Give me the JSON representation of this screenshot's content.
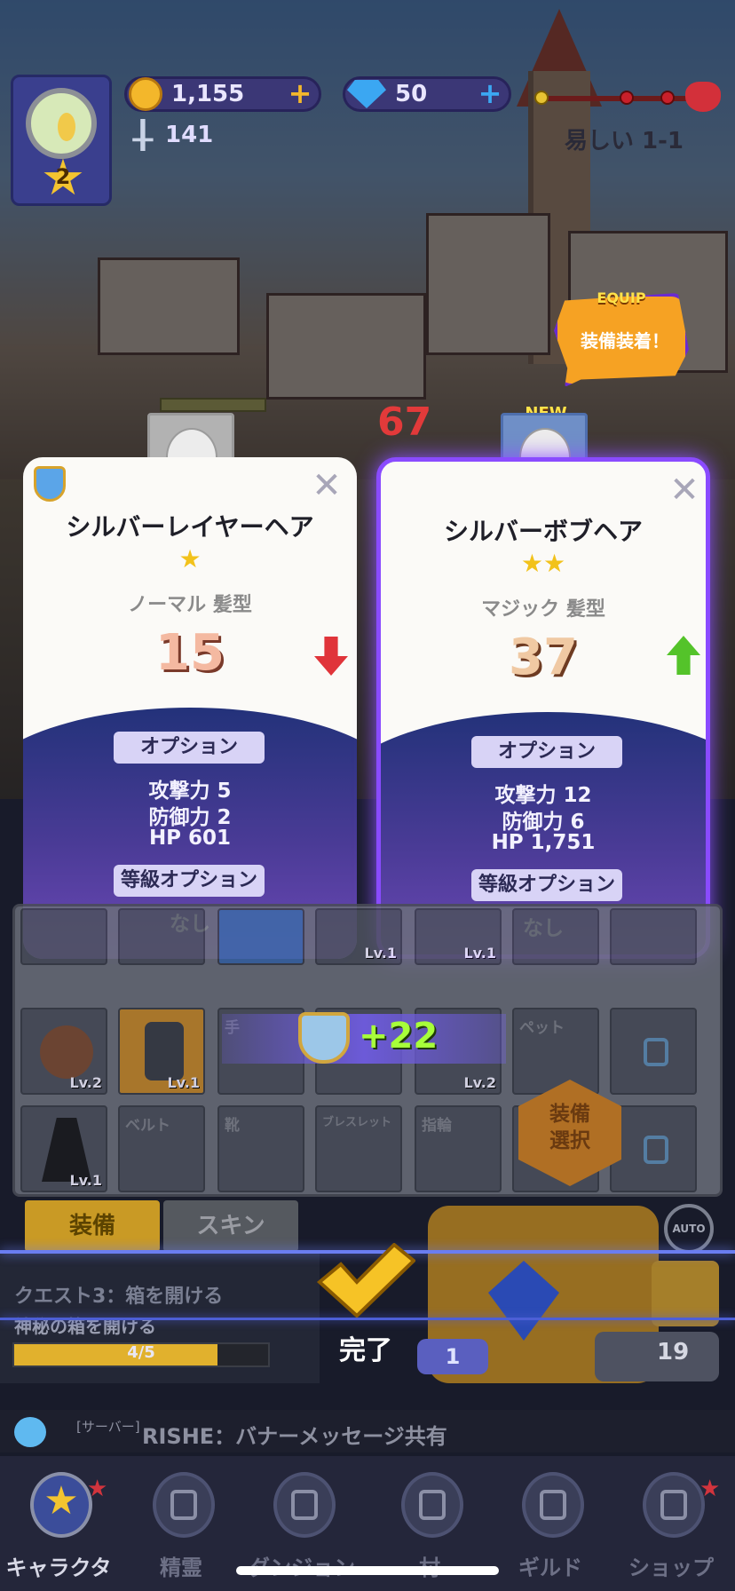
{
  "hud": {
    "player_level": "2",
    "gold": "1,155",
    "gems": "50",
    "combat_power": "141",
    "stage": "易しい 1-1"
  },
  "equip_bubble": {
    "tag": "EQUIP",
    "text": "装備装着！"
  },
  "battle": {
    "damage": "67"
  },
  "cards": [
    {
      "name": "シルバーレイヤーヘア",
      "stars": "★",
      "type": "ノーマル 髪型",
      "power": "15",
      "option_label": "オプション",
      "stats": [
        "攻撃力 5",
        "防御力 2",
        "HP 601"
      ],
      "grade_option_label": "等級オプション",
      "grade_option_value": "なし",
      "comparison": "down"
    },
    {
      "badge": "NEW",
      "name": "シルバーボブヘア",
      "stars": "★★",
      "type": "マジック 髪型",
      "power": "37",
      "option_label": "オプション",
      "stats": [
        "攻撃力 12",
        "防御力 6",
        "HP 1,751"
      ],
      "grade_option_label": "等級オプション",
      "grade_option_value": "なし",
      "comparison": "up"
    }
  ],
  "inventory": {
    "bonus": "+22",
    "slots_row2": [
      {
        "lv": "Lv.2"
      },
      {
        "lv": "Lv.1"
      },
      {
        "label": "手"
      },
      {
        "label": ""
      },
      {
        "lv": "Lv.2"
      },
      {
        "label": "ペット"
      },
      {
        "label": "",
        "locked": true
      }
    ],
    "slots_row3": [
      {
        "lv": "Lv.1"
      },
      {
        "label": "ベルト"
      },
      {
        "label": "靴"
      },
      {
        "label": "ブレスレット"
      },
      {
        "label": "指輪"
      }
    ],
    "slots_row1_lv": [
      "Lv.1",
      "Lv.1"
    ],
    "select_gear": "装備\n選択",
    "tab_equip": "装備",
    "tab_skin": "スキン",
    "auto_label": "AUTO"
  },
  "quest": {
    "title": "クエスト3：箱を開ける",
    "description": "神秘の箱を開ける",
    "progress_text": "4/5",
    "progress_value": 0.8
  },
  "chest": {
    "count": "1",
    "tickets": "19"
  },
  "done": {
    "label": "完了"
  },
  "banner": {
    "tag": "[サーバー]",
    "text": "RISHE：バナーメッセージ共有"
  },
  "nav": [
    {
      "label": "キャラクター",
      "icon": "star-icon",
      "active": true,
      "badge": true
    },
    {
      "label": "精霊",
      "icon": "lock-icon"
    },
    {
      "label": "ダンジョン",
      "icon": "lock-icon"
    },
    {
      "label": "村",
      "icon": "lock-icon"
    },
    {
      "label": "ギルド",
      "icon": "lock-icon"
    },
    {
      "label": "ショップ",
      "icon": "lock-icon",
      "badge": true
    }
  ],
  "colors": {
    "gold": "#f3b72b",
    "new_glow": "#8a4bff",
    "down_arrow": "#e0343a",
    "up_arrow": "#54c32a"
  }
}
